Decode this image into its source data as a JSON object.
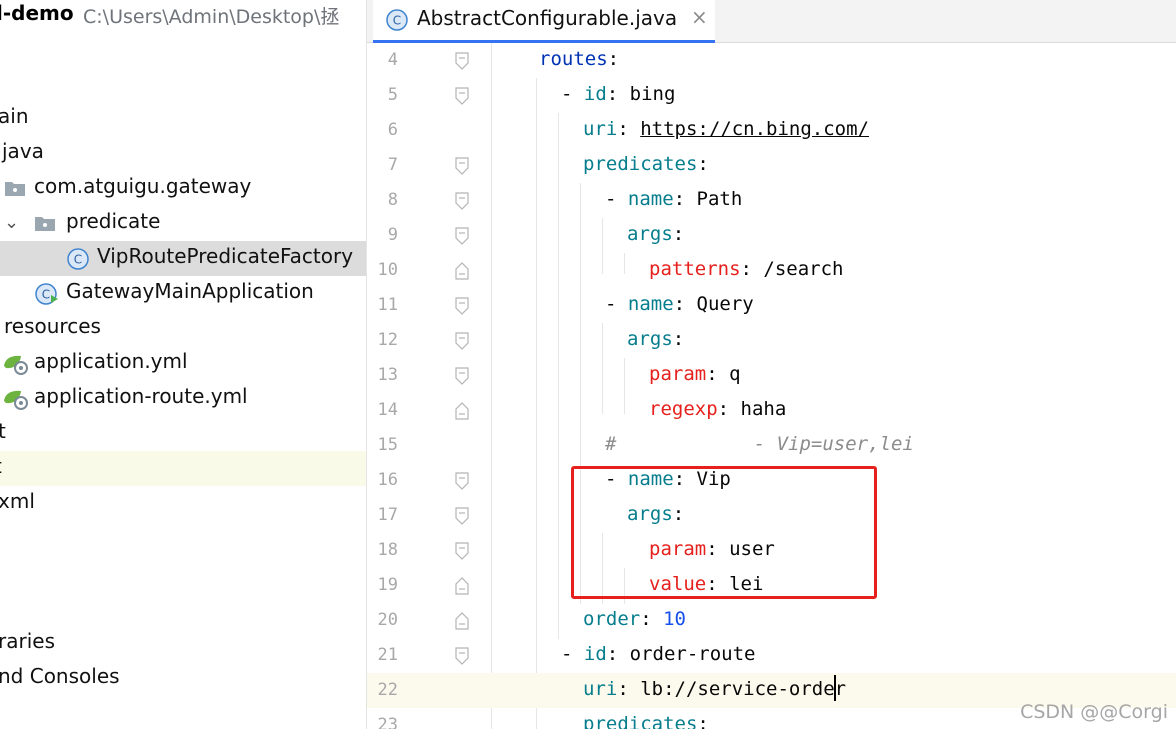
{
  "project": {
    "name": "l-demo",
    "path": "C:\\Users\\Admin\\Desktop\\拯",
    "tree": [
      {
        "id": "main",
        "label": "ain",
        "kind": "folder"
      },
      {
        "id": "java",
        "label": "java",
        "kind": "folder-src"
      },
      {
        "id": "pkg",
        "label": "com.atguigu.gateway",
        "kind": "package"
      },
      {
        "id": "predicate",
        "label": "predicate",
        "kind": "package"
      },
      {
        "id": "vip",
        "label": "VipRoutePredicateFactory",
        "kind": "class",
        "selected": true
      },
      {
        "id": "gwmain",
        "label": "GatewayMainApplication",
        "kind": "app-class"
      },
      {
        "id": "resources",
        "label": "resources",
        "kind": "folder-res"
      },
      {
        "id": "appyml",
        "label": "application.yml",
        "kind": "spring-yml"
      },
      {
        "id": "routeyml",
        "label": "application-route.yml",
        "kind": "spring-yml"
      },
      {
        "id": "test",
        "label": "t",
        "kind": "folder"
      },
      {
        "id": "target",
        "label": "t",
        "kind": "folder",
        "hover": true
      },
      {
        "id": "pom",
        "label": "xml",
        "kind": "file"
      },
      {
        "id": "libs",
        "label": "raries",
        "kind": "libs"
      },
      {
        "id": "scratches",
        "label": "nd Consoles",
        "kind": "scratches"
      }
    ]
  },
  "editor": {
    "tab": {
      "label": "AbstractConfigurable.java",
      "close": "×"
    },
    "lines": [
      {
        "n": "4",
        "tokens": [
          {
            "t": "routes",
            "c": "kb"
          },
          {
            "t": ":",
            "c": ""
          }
        ]
      },
      {
        "n": "5",
        "tokens": [
          {
            "t": "- ",
            "c": ""
          },
          {
            "t": "id",
            "c": "kt"
          },
          {
            "t": ": bing",
            "c": ""
          }
        ]
      },
      {
        "n": "6",
        "tokens": [
          {
            "t": "uri",
            "c": "kt"
          },
          {
            "t": ": ",
            "c": ""
          },
          {
            "t": "https://cn.bing.com/",
            "c": "url"
          }
        ]
      },
      {
        "n": "7",
        "tokens": [
          {
            "t": "predicates",
            "c": "kt"
          },
          {
            "t": ":",
            "c": ""
          }
        ]
      },
      {
        "n": "8",
        "tokens": [
          {
            "t": "- ",
            "c": ""
          },
          {
            "t": "name",
            "c": "kt"
          },
          {
            "t": ": Path",
            "c": ""
          }
        ]
      },
      {
        "n": "9",
        "tokens": [
          {
            "t": "args",
            "c": "kt"
          },
          {
            "t": ":",
            "c": ""
          }
        ]
      },
      {
        "n": "10",
        "tokens": [
          {
            "t": "patterns",
            "c": "kr"
          },
          {
            "t": ": /search",
            "c": ""
          }
        ]
      },
      {
        "n": "11",
        "tokens": [
          {
            "t": "- ",
            "c": ""
          },
          {
            "t": "name",
            "c": "kt"
          },
          {
            "t": ": Query",
            "c": ""
          }
        ]
      },
      {
        "n": "12",
        "tokens": [
          {
            "t": "args",
            "c": "kt"
          },
          {
            "t": ":",
            "c": ""
          }
        ]
      },
      {
        "n": "13",
        "tokens": [
          {
            "t": "param",
            "c": "kr"
          },
          {
            "t": ": q",
            "c": ""
          }
        ]
      },
      {
        "n": "14",
        "tokens": [
          {
            "t": "regexp",
            "c": "kr"
          },
          {
            "t": ": haha",
            "c": ""
          }
        ]
      },
      {
        "n": "15",
        "tokens": [
          {
            "t": "#            - Vip=user,lei",
            "c": "cmt"
          }
        ]
      },
      {
        "n": "16",
        "tokens": [
          {
            "t": "- ",
            "c": ""
          },
          {
            "t": "name",
            "c": "kt"
          },
          {
            "t": ": Vip",
            "c": ""
          }
        ]
      },
      {
        "n": "17",
        "tokens": [
          {
            "t": "args",
            "c": "kt"
          },
          {
            "t": ":",
            "c": ""
          }
        ]
      },
      {
        "n": "18",
        "tokens": [
          {
            "t": "param",
            "c": "kr"
          },
          {
            "t": ": user",
            "c": ""
          }
        ]
      },
      {
        "n": "19",
        "tokens": [
          {
            "t": "value",
            "c": "kr"
          },
          {
            "t": ": lei",
            "c": ""
          }
        ]
      },
      {
        "n": "20",
        "tokens": [
          {
            "t": "order",
            "c": "kt"
          },
          {
            "t": ": ",
            "c": ""
          },
          {
            "t": "10",
            "c": "num"
          }
        ]
      },
      {
        "n": "21",
        "tokens": [
          {
            "t": "- ",
            "c": ""
          },
          {
            "t": "id",
            "c": "kt"
          },
          {
            "t": ": order-route",
            "c": ""
          }
        ]
      },
      {
        "n": "22",
        "tokens": [
          {
            "t": "uri",
            "c": "kt"
          },
          {
            "t": ": lb://service-order",
            "c": ""
          }
        ]
      },
      {
        "n": "23",
        "tokens": [
          {
            "t": "predicates",
            "c": "kt"
          },
          {
            "t": ":",
            "c": ""
          }
        ]
      }
    ]
  },
  "watermark": "CSDN @@Corgi"
}
